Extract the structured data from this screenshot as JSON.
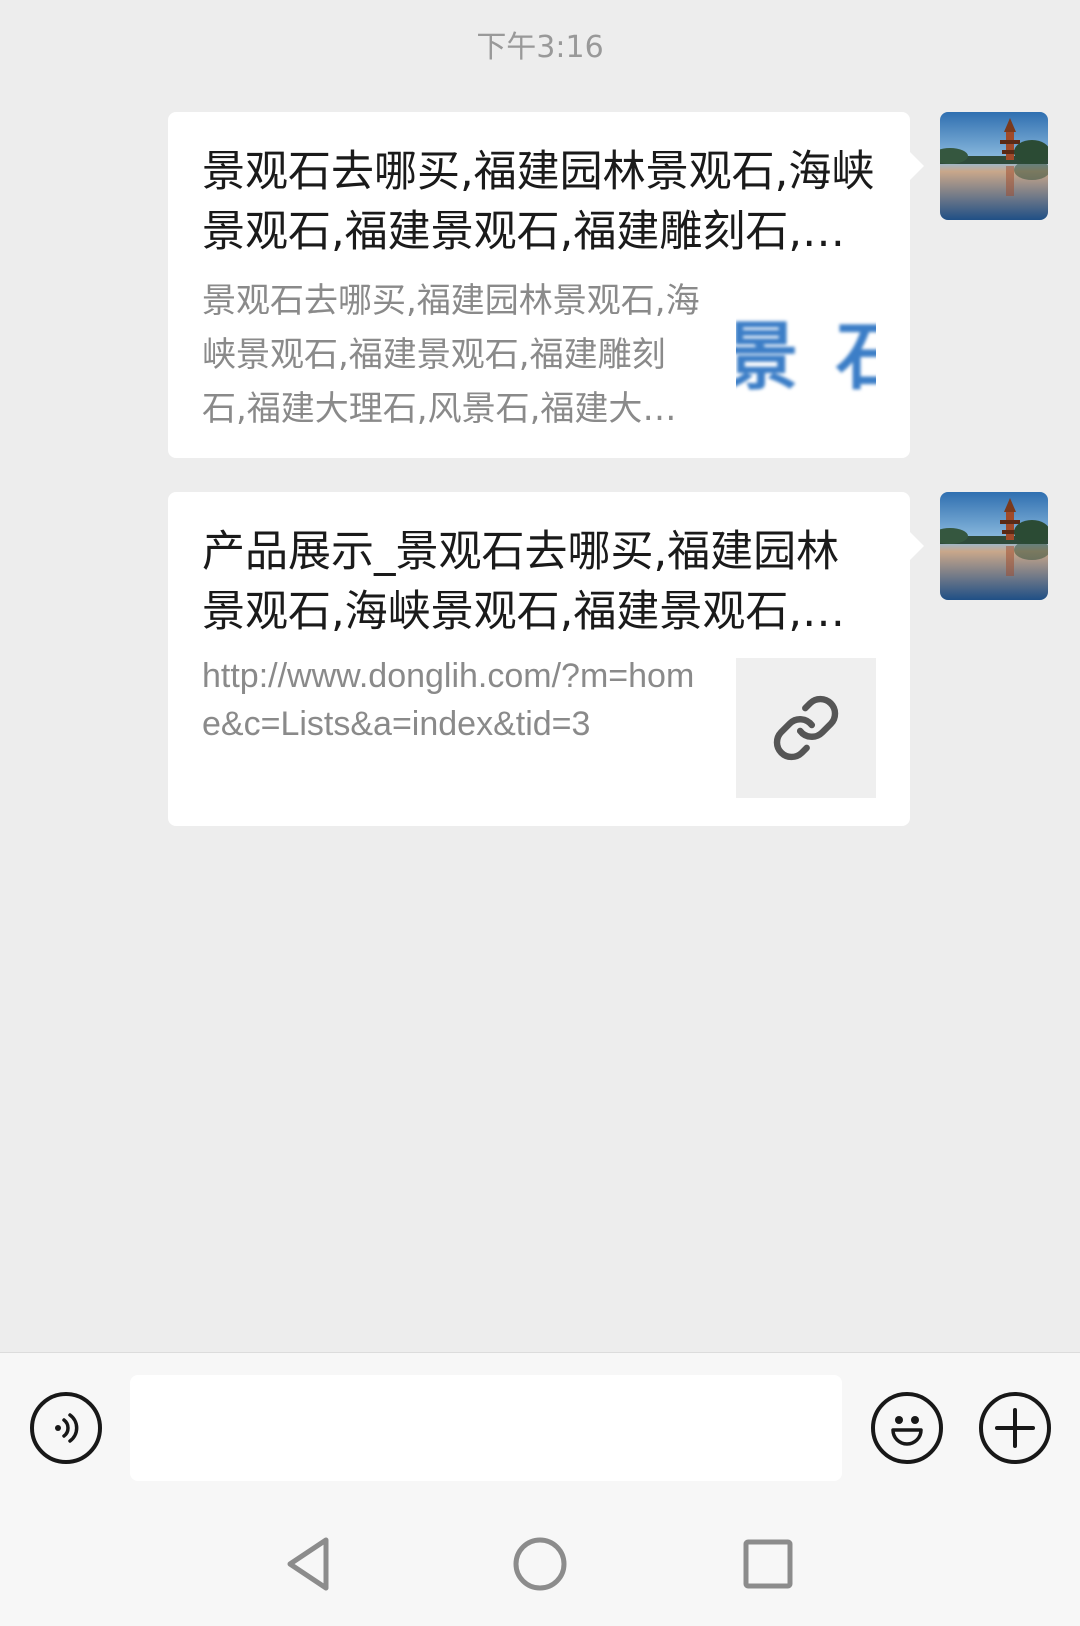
{
  "chat": {
    "timestamp": "下午3:16",
    "messages": [
      {
        "title": "景观石去哪买,福建园林景观石,海峡景观石,福建景观石,福建雕刻石,福建大理石,风景石",
        "description": "景观石去哪买,福建园林景观石,海峡景观石,福建景观石,福建雕刻石,福建大理石,风景石,福建大理石",
        "thumb_text": "景 石",
        "avatar_icon": "avatar-temple-lake"
      },
      {
        "title": "产品展示_景观石去哪买,福建园林景观石,海峡景观石,福建景观石,福建雕刻石",
        "description": "http://www.donglih.com/?m=home&c=Lists&a=index&tid=3",
        "thumb_icon": "link-icon",
        "avatar_icon": "avatar-temple-lake"
      }
    ]
  },
  "input_bar": {
    "voice_icon": "voice-icon",
    "message_value": "",
    "emoji_icon": "emoji-icon",
    "more_icon": "plus-icon"
  },
  "nav": {
    "back_icon": "back-triangle-icon",
    "home_icon": "home-circle-icon",
    "recents_icon": "recents-square-icon"
  },
  "colors": {
    "chat_background": "#ededed",
    "card_background": "#ffffff",
    "title_text": "#1a1a1a",
    "description_text": "#8a8a8a",
    "timestamp_text": "#999999",
    "thumb_glyph": "#3c7ec7"
  }
}
